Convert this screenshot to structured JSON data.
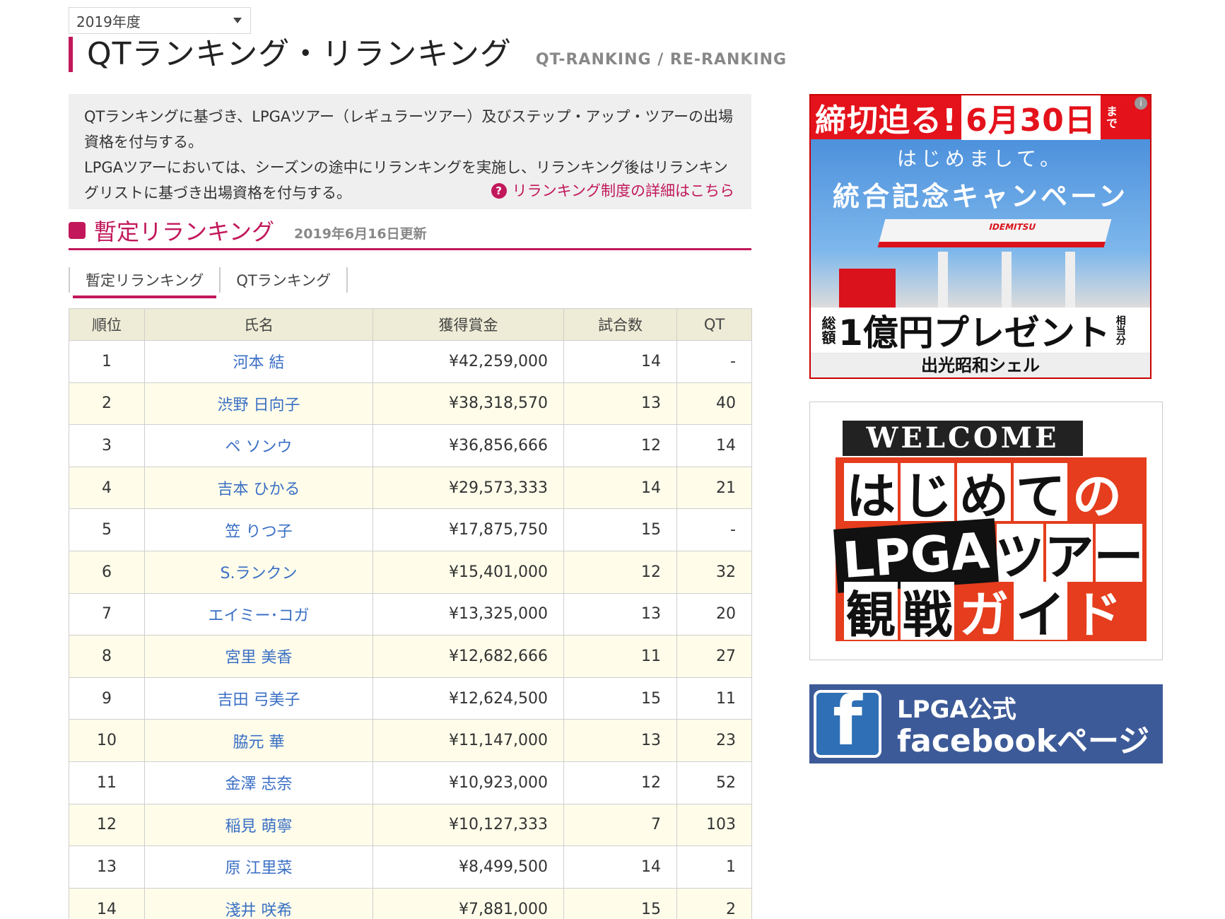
{
  "year_select": {
    "value": "2019年度"
  },
  "page_title": {
    "jp": "QTランキング・リランキング",
    "en": "QT-RANKING / RE-RANKING"
  },
  "description": {
    "line1": "QTランキングに基づき、LPGAツアー（レギュラーツアー）及びステップ・アップ・ツアーの出場資格を付与する。",
    "line2": "LPGAツアーにおいては、シーズンの途中にリランキングを実施し、リランキング後はリランキングリストに基づき出場資格を付与する。",
    "help_link": "リランキング制度の詳細はこちら"
  },
  "section": {
    "title": "暫定リランキング",
    "updated": "2019年6月16日更新"
  },
  "tabs": [
    {
      "label": "暫定リランキング"
    },
    {
      "label": "QTランキング"
    }
  ],
  "table": {
    "headers": [
      "順位",
      "氏名",
      "獲得賞金",
      "試合数",
      "QT"
    ],
    "rows": [
      {
        "rank": "1",
        "name": "河本 結",
        "prize": "¥42,259,000",
        "games": "14",
        "qt": "-"
      },
      {
        "rank": "2",
        "name": "渋野 日向子",
        "prize": "¥38,318,570",
        "games": "13",
        "qt": "40"
      },
      {
        "rank": "3",
        "name": "ペ ソンウ",
        "prize": "¥36,856,666",
        "games": "12",
        "qt": "14"
      },
      {
        "rank": "4",
        "name": "吉本 ひかる",
        "prize": "¥29,573,333",
        "games": "14",
        "qt": "21"
      },
      {
        "rank": "5",
        "name": "笠 りつ子",
        "prize": "¥17,875,750",
        "games": "15",
        "qt": "-"
      },
      {
        "rank": "6",
        "name": "S.ランクン",
        "prize": "¥15,401,000",
        "games": "12",
        "qt": "32"
      },
      {
        "rank": "7",
        "name": "エイミー･コガ",
        "prize": "¥13,325,000",
        "games": "13",
        "qt": "20"
      },
      {
        "rank": "8",
        "name": "宮里 美香",
        "prize": "¥12,682,666",
        "games": "11",
        "qt": "27"
      },
      {
        "rank": "9",
        "name": "吉田 弓美子",
        "prize": "¥12,624,500",
        "games": "15",
        "qt": "11"
      },
      {
        "rank": "10",
        "name": "脇元 華",
        "prize": "¥11,147,000",
        "games": "13",
        "qt": "23"
      },
      {
        "rank": "11",
        "name": "金澤 志奈",
        "prize": "¥10,923,000",
        "games": "12",
        "qt": "52"
      },
      {
        "rank": "12",
        "name": "稲見 萌寧",
        "prize": "¥10,127,333",
        "games": "7",
        "qt": "103"
      },
      {
        "rank": "13",
        "name": "原 江里菜",
        "prize": "¥8,499,500",
        "games": "14",
        "qt": "1"
      },
      {
        "rank": "14",
        "name": "淺井 咲希",
        "prize": "¥7,881,000",
        "games": "15",
        "qt": "2"
      }
    ]
  },
  "ads": {
    "idemitsu": {
      "deadline": "締切迫る!",
      "date": "6月30日",
      "date_suffix": "まで",
      "greeting": "はじめまして。",
      "campaign": "統合記念キャンペーン",
      "present": "1億円プレゼント",
      "present_prefix": "総額",
      "present_mid": "相当分",
      "brand": "出光昭和シェル",
      "station_sign": "IDEMITSU"
    },
    "guide": {
      "welcome": "WELCOME",
      "row1": [
        "は",
        "じ",
        "め",
        "て",
        "の"
      ],
      "lpga": "LPGA",
      "row2": [
        "ツ",
        "ア",
        "ー"
      ],
      "row3": [
        "観",
        "戦",
        "ガ",
        "イ",
        "ド"
      ]
    },
    "facebook": {
      "line1": "LPGA公式",
      "line2": "facebookページ",
      "icon": "f"
    }
  },
  "colors": {
    "accent": "#c2185b",
    "link": "#3a6fc4",
    "header_bg": "#eeecd6",
    "alt_row": "#fffdea"
  }
}
